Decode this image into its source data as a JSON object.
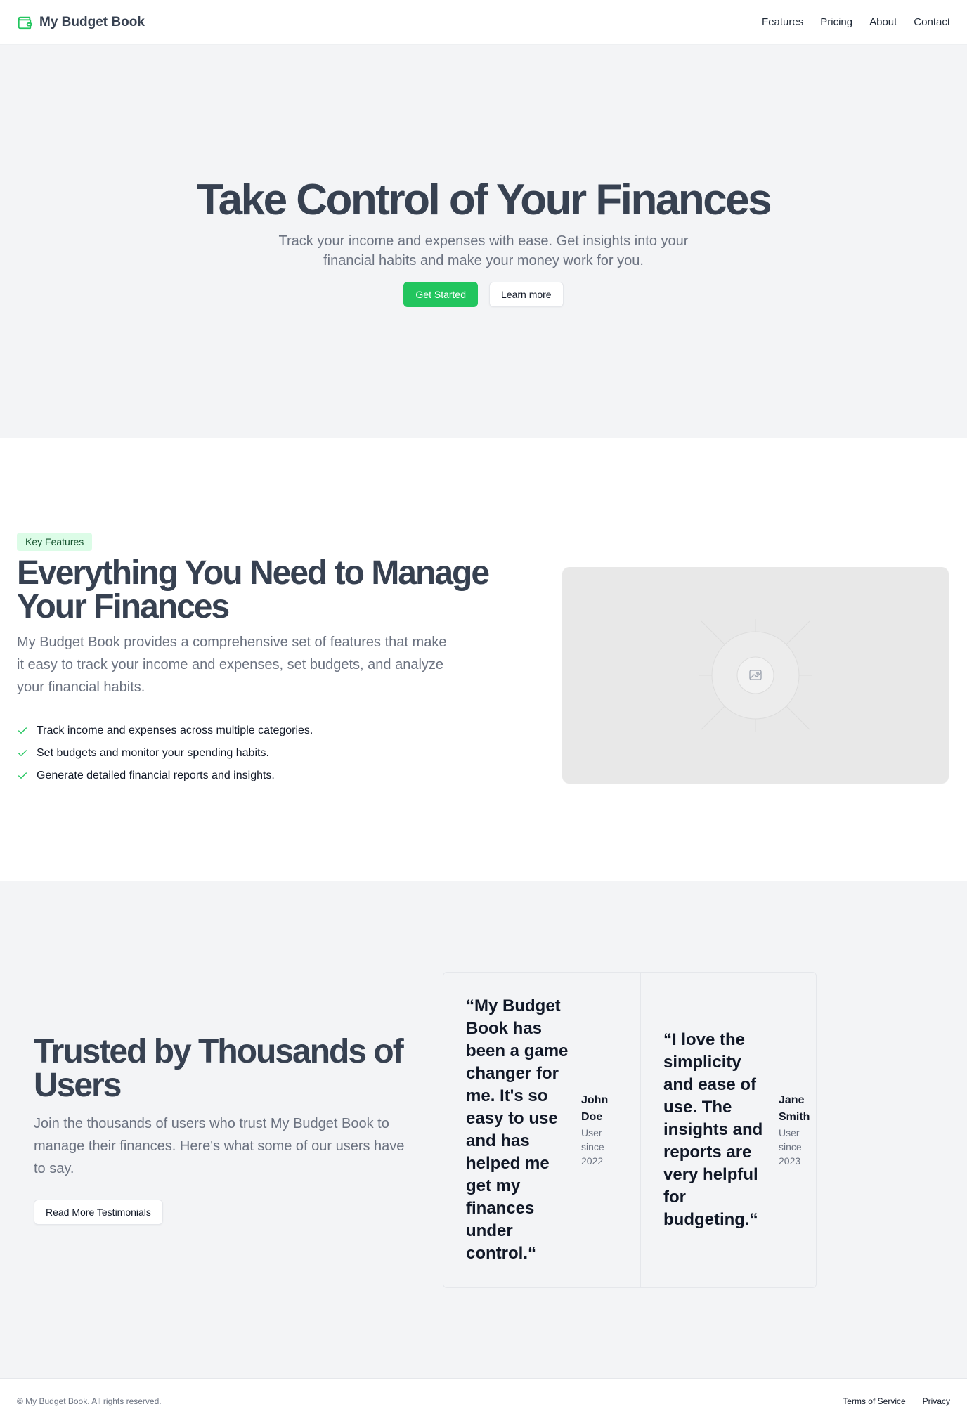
{
  "header": {
    "brand_name": "My Budget Book",
    "brand_icon": "wallet-icon",
    "nav": [
      "Features",
      "Pricing",
      "About",
      "Contact"
    ]
  },
  "hero": {
    "title": "Take Control of Your Finances",
    "subtitle": "Track your income and expenses with ease. Get insights into your financial habits and make your money work for you.",
    "primary_button": "Get Started",
    "secondary_button": "Learn more"
  },
  "features": {
    "badge": "Key Features",
    "title": "Everything You Need to Manage Your Finances",
    "description": "My Budget Book provides a comprehensive set of features that make it easy to track your income and expenses, set budgets, and analyze your financial habits.",
    "items": [
      "Track income and expenses across multiple categories.",
      "Set budgets and monitor your spending habits.",
      "Generate detailed financial reports and insights."
    ],
    "image_icon": "image-placeholder-icon"
  },
  "testimonials": {
    "title": "Trusted by Thousands of Users",
    "description": "Join the thousands of users who trust My Budget Book to manage their finances. Here's what some of our users have to say.",
    "button": "Read More Testimonials",
    "items": [
      {
        "quote": "“My Budget Book has been a game changer for me. It's so easy to use and has helped me get my finances under control.“",
        "name": "John Doe",
        "since": "User since 2022"
      },
      {
        "quote": "“I love the simplicity and ease of use. The insights and reports are very helpful for budgeting.“",
        "name": "Jane Smith",
        "since": "User since 2023"
      }
    ]
  },
  "footer": {
    "copyright": "© My Budget Book. All rights reserved.",
    "links": [
      "Terms of Service",
      "Privacy"
    ]
  },
  "colors": {
    "accent": "#22c55e",
    "heading": "#374151",
    "muted": "#6b7280",
    "section_bg": "#f3f4f6"
  }
}
